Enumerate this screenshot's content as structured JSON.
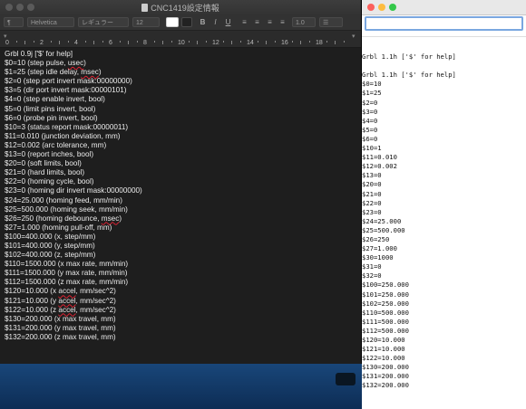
{
  "window_title": "CNC1419設定情報",
  "toolbar": {
    "style_value": "¶",
    "font_value": "Helvetica",
    "weight_value": "レギュラー",
    "size_value": "12",
    "bold": "B",
    "italic": "I",
    "underline": "U",
    "spacing_value": "1.0",
    "list_value": "☰"
  },
  "ruler": {
    "numbers": [
      "0",
      "2",
      "4",
      "6",
      "8",
      "10",
      "12",
      "14",
      "16",
      "18"
    ]
  },
  "editor_lines": [
    "Grbl 0.9j ['$' for help]",
    "$0=10 (step pulse, usec)",
    "$1=25 (step idle delay, msec)",
    "$2=0 (step port invert mask:00000000)",
    "$3=5 (dir port invert mask:00000101)",
    "$4=0 (step enable invert, bool)",
    "$5=0 (limit pins invert, bool)",
    "$6=0 (probe pin invert, bool)",
    "$10=3 (status report mask:00000011)",
    "$11=0.010 (junction deviation, mm)",
    "$12=0.002 (arc tolerance, mm)",
    "$13=0 (report inches, bool)",
    "$20=0 (soft limits, bool)",
    "$21=0 (hard limits, bool)",
    "$22=0 (homing cycle, bool)",
    "$23=0 (homing dir invert mask:00000000)",
    "$24=25.000 (homing feed, mm/min)",
    "$25=500.000 (homing seek, mm/min)",
    "$26=250 (homing debounce, msec)",
    "$27=1.000 (homing pull-off, mm)",
    "$100=400.000 (x, step/mm)",
    "$101=400.000 (y, step/mm)",
    "$102=400.000 (z, step/mm)",
    "$110=1500.000 (x max rate, mm/min)",
    "$111=1500.000 (y max rate, mm/min)",
    "$112=1500.000 (z max rate, mm/min)",
    "$120=10.000 (x accel, mm/sec^2)",
    "$121=10.000 (y accel, mm/sec^2)",
    "$122=10.000 (z accel, mm/sec^2)",
    "$130=200.000 (x max travel, mm)",
    "$131=200.000 (y max travel, mm)",
    "$132=200.000 (z max travel, mm)"
  ],
  "serial_monitor": {
    "input_value": "",
    "lines": [
      "",
      "Grbl 1.1h ['$' for help]",
      "",
      "Grbl 1.1h ['$' for help]",
      "$0=10",
      "$1=25",
      "$2=0",
      "$3=0",
      "$4=0",
      "$5=0",
      "$6=0",
      "$10=1",
      "$11=0.010",
      "$12=0.002",
      "$13=0",
      "$20=0",
      "$21=0",
      "$22=0",
      "$23=0",
      "$24=25.000",
      "$25=500.000",
      "$26=250",
      "$27=1.000",
      "$30=1000",
      "$31=0",
      "$32=0",
      "$100=250.000",
      "$101=250.000",
      "$102=250.000",
      "$110=500.000",
      "$111=500.000",
      "$112=500.000",
      "$120=10.000",
      "$121=10.000",
      "$122=10.000",
      "$130=200.000",
      "$131=200.000",
      "$132=200.000"
    ]
  },
  "colors": {
    "close": "#fc605c",
    "minimize": "#fdbc40",
    "zoom": "#34c84a"
  }
}
